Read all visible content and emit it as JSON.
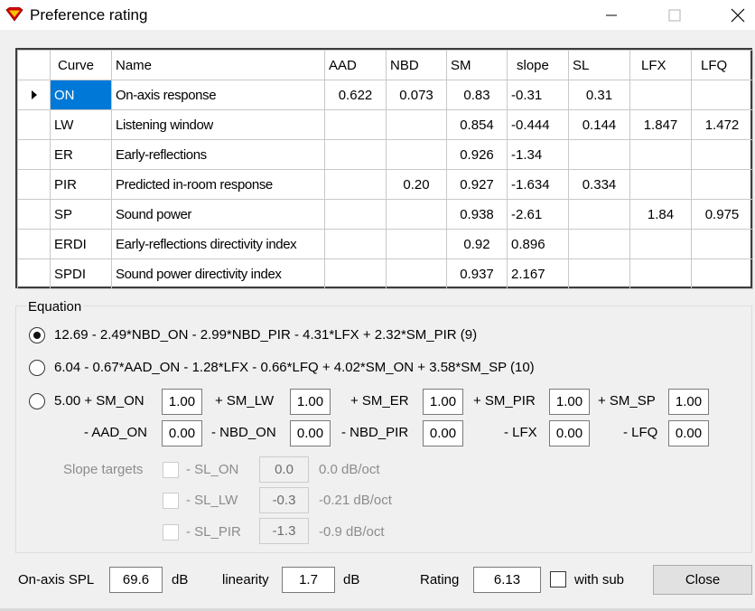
{
  "window": {
    "title": "Preference rating",
    "icon": "superman-shield-icon",
    "accent_color": "#0078d7"
  },
  "table": {
    "columns": [
      "Curve",
      "Name",
      "AAD",
      "NBD",
      "SM",
      "slope",
      "SL",
      "LFX",
      "LFQ"
    ],
    "rows": [
      {
        "curve": "ON",
        "name": "On-axis response",
        "aad": "0.622",
        "nbd": "0.073",
        "sm": "0.83",
        "slope": "-0.31",
        "sl": "0.31",
        "lfx": "",
        "lfq": ""
      },
      {
        "curve": "LW",
        "name": "Listening window",
        "aad": "",
        "nbd": "",
        "sm": "0.854",
        "slope": "-0.444",
        "sl": "0.144",
        "lfx": "1.847",
        "lfq": "1.472"
      },
      {
        "curve": "ER",
        "name": "Early-reflections",
        "aad": "",
        "nbd": "",
        "sm": "0.926",
        "slope": "-1.34",
        "sl": "",
        "lfx": "",
        "lfq": ""
      },
      {
        "curve": "PIR",
        "name": "Predicted in-room response",
        "aad": "",
        "nbd": "0.20",
        "sm": "0.927",
        "slope": "-1.634",
        "sl": "0.334",
        "lfx": "",
        "lfq": ""
      },
      {
        "curve": "SP",
        "name": "Sound power",
        "aad": "",
        "nbd": "",
        "sm": "0.938",
        "slope": "-2.61",
        "sl": "",
        "lfx": "1.84",
        "lfq": "0.975"
      },
      {
        "curve": "ERDI",
        "name": "Early-reflections directivity index",
        "aad": "",
        "nbd": "",
        "sm": "0.92",
        "slope": "0.896",
        "sl": "",
        "lfx": "",
        "lfq": ""
      },
      {
        "curve": "SPDI",
        "name": "Sound power directivity index",
        "aad": "",
        "nbd": "",
        "sm": "0.937",
        "slope": "2.167",
        "sl": "",
        "lfx": "",
        "lfq": ""
      }
    ]
  },
  "equation": {
    "group_label": "Equation",
    "option1": "12.69 - 2.49*NBD_ON - 2.99*NBD_PIR - 4.31*LFX + 2.32*SM_PIR (9)",
    "option2": "6.04 - 0.67*AAD_ON - 1.28*LFX - 0.66*LFQ + 4.02*SM_ON + 3.58*SM_SP (10)",
    "option3": {
      "prefix": "5.00 + SM_ON",
      "sm_on": "1.00",
      "sm_lw_label": "+ SM_LW",
      "sm_lw": "1.00",
      "sm_er_label": "+ SM_ER",
      "sm_er": "1.00",
      "sm_pir_label": "+ SM_PIR",
      "sm_pir": "1.00",
      "sm_sp_label": "+ SM_SP",
      "sm_sp": "1.00",
      "aad_on_label": "- AAD_ON",
      "aad_on": "0.00",
      "nbd_on_label": "- NBD_ON",
      "nbd_on": "0.00",
      "nbd_pir_label": "- NBD_PIR",
      "nbd_pir": "0.00",
      "lfx_label": "- LFX",
      "lfx": "0.00",
      "lfq_label": "- LFQ",
      "lfq": "0.00"
    },
    "slope_targets": {
      "label": "Slope targets",
      "items": [
        {
          "label": "- SL_ON",
          "value": "0.0",
          "note": "0.0 dB/oct"
        },
        {
          "label": "- SL_LW",
          "value": "-0.3",
          "note": "-0.21 dB/oct"
        },
        {
          "label": "- SL_PIR",
          "value": "-1.3",
          "note": "-0.9 dB/oct"
        }
      ]
    }
  },
  "footer": {
    "onaxis_label": "On-axis SPL",
    "onaxis_value": "69.6",
    "onaxis_unit": "dB",
    "linearity_label": "linearity",
    "linearity_value": "1.7",
    "linearity_unit": "dB",
    "rating_label": "Rating",
    "rating_value": "6.13",
    "with_sub_label": "with sub",
    "close_label": "Close"
  }
}
